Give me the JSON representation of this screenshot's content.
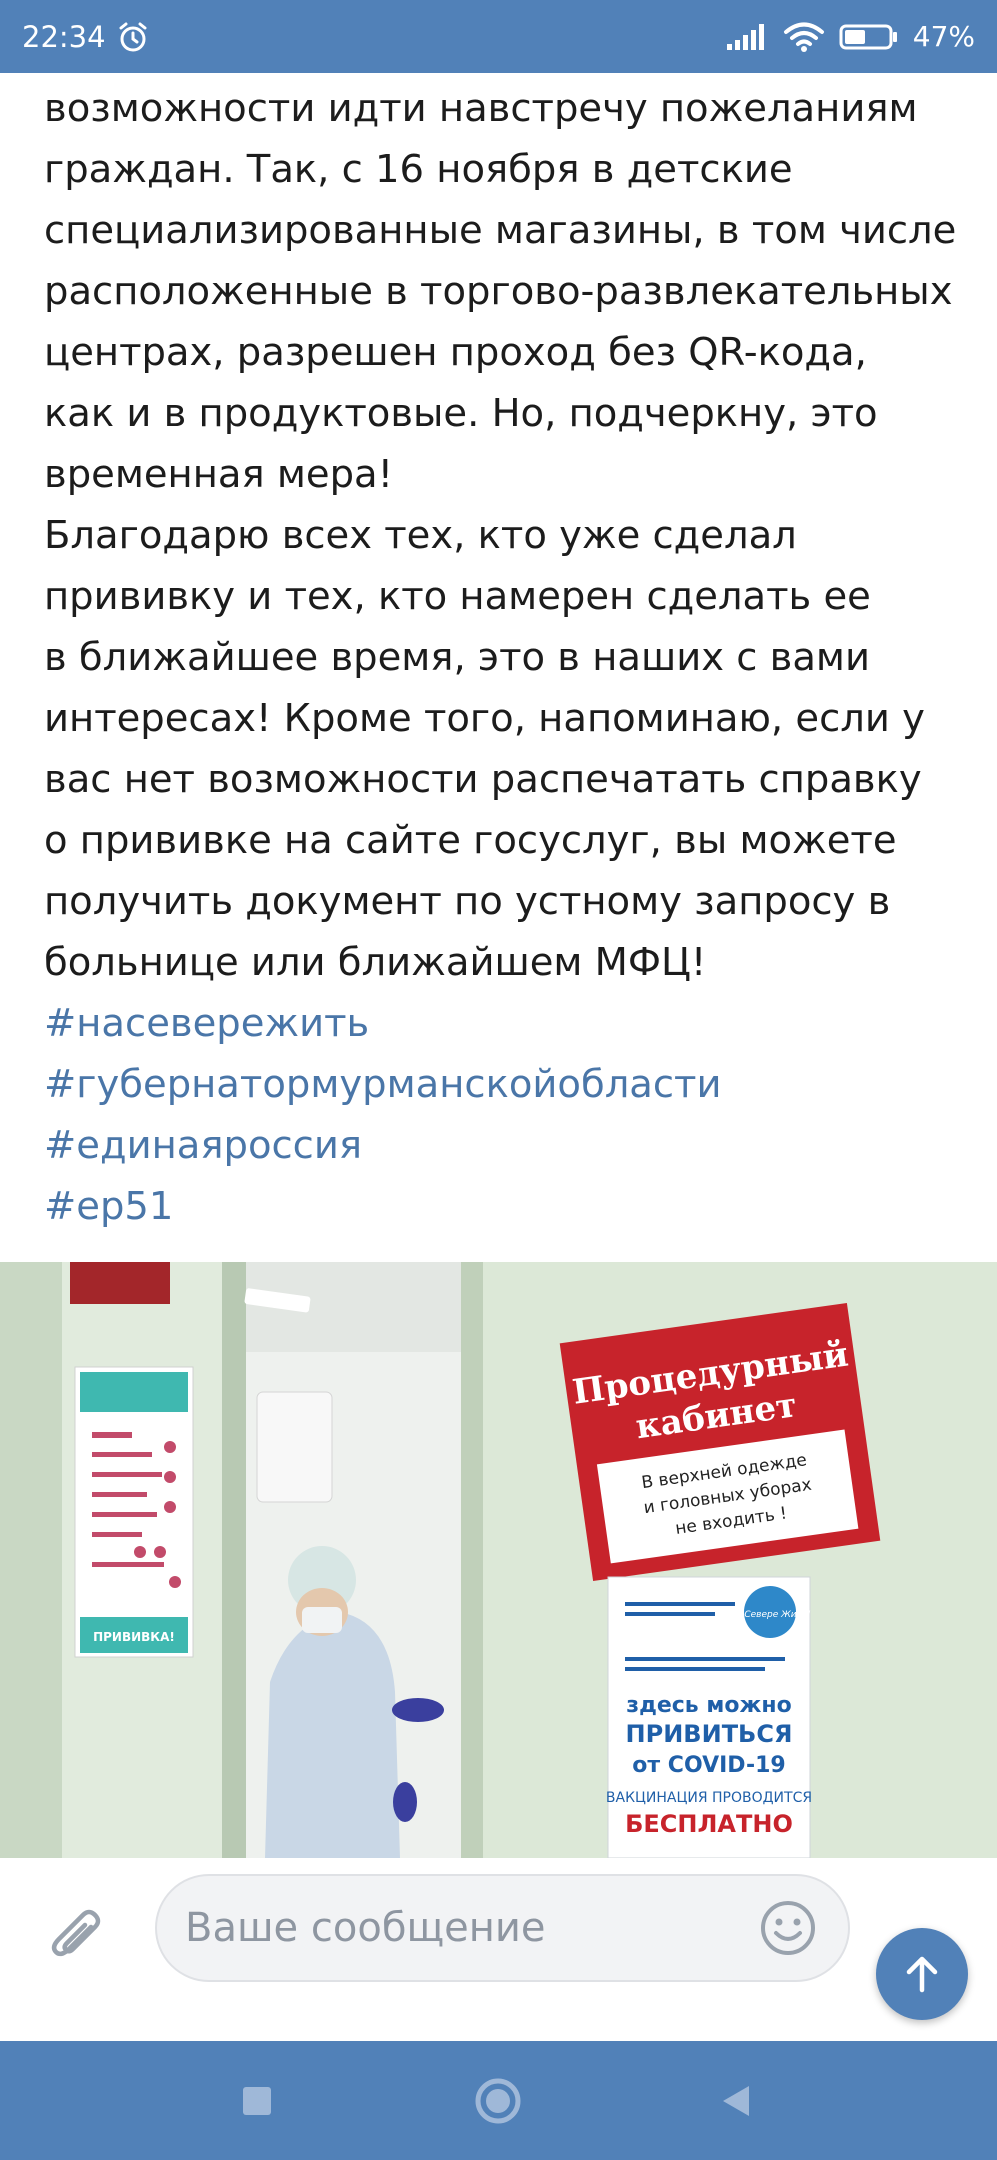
{
  "status_bar": {
    "time": "22:34",
    "battery_percent": "47%"
  },
  "post": {
    "lines": [
      "возможности идти навстречу пожеланиям",
      "граждан. Так, с 16 ноября в детские",
      "специализированные магазины, в том числе",
      "расположенные в торгово-развлекательных",
      "центрах, разрешен проход без QR-кода,",
      "как и в продуктовые. Но, подчеркну, это",
      "временная мера!",
      "Благодарю всех тех, кто уже сделал",
      "прививку и тех, кто намерен сделать ее",
      "в ближайшее время, это в наших с вами",
      "интересах! Кроме того, напоминаю, если у",
      "вас нет возможности распечатать справку",
      "о прививке на сайте госуслуг, вы можете",
      "получить документ по устному запросу в",
      "больнице или ближайшем МФЦ!"
    ],
    "hashtags": [
      "#насевережить",
      "#губернатормурманскойобласти",
      "#единаяроссия",
      "#ер51"
    ]
  },
  "photo": {
    "sign_title_line1": "Процедурный",
    "sign_title_line2": "кабинет",
    "sign_note_line1": "В верхней одежде",
    "sign_note_line2": "и головных уборах",
    "sign_note_line3": "не входить !",
    "poster_line1": "здесь можно",
    "poster_line2": "ПРИВИТЬСЯ",
    "poster_line3": "от COVID-19",
    "poster_line4": "ВАКЦИНАЦИЯ ПРОВОДИТСЯ",
    "poster_line5": "БЕСПЛАТНО",
    "poster_logo": "На Севере Жить!",
    "left_poster_bottom": "ПРИВИВКА!"
  },
  "composer": {
    "placeholder": "Ваше сообщение"
  },
  "colors": {
    "brand": "#5181b8",
    "hashtag": "#4a76a8",
    "text": "#1c1c1c"
  },
  "icons": {
    "attach": "paperclip-icon",
    "emoji": "smiley-icon",
    "send": "arrow-up-icon",
    "nav_recent": "square-icon",
    "nav_home": "circle-icon",
    "nav_back": "triangle-back-icon"
  }
}
